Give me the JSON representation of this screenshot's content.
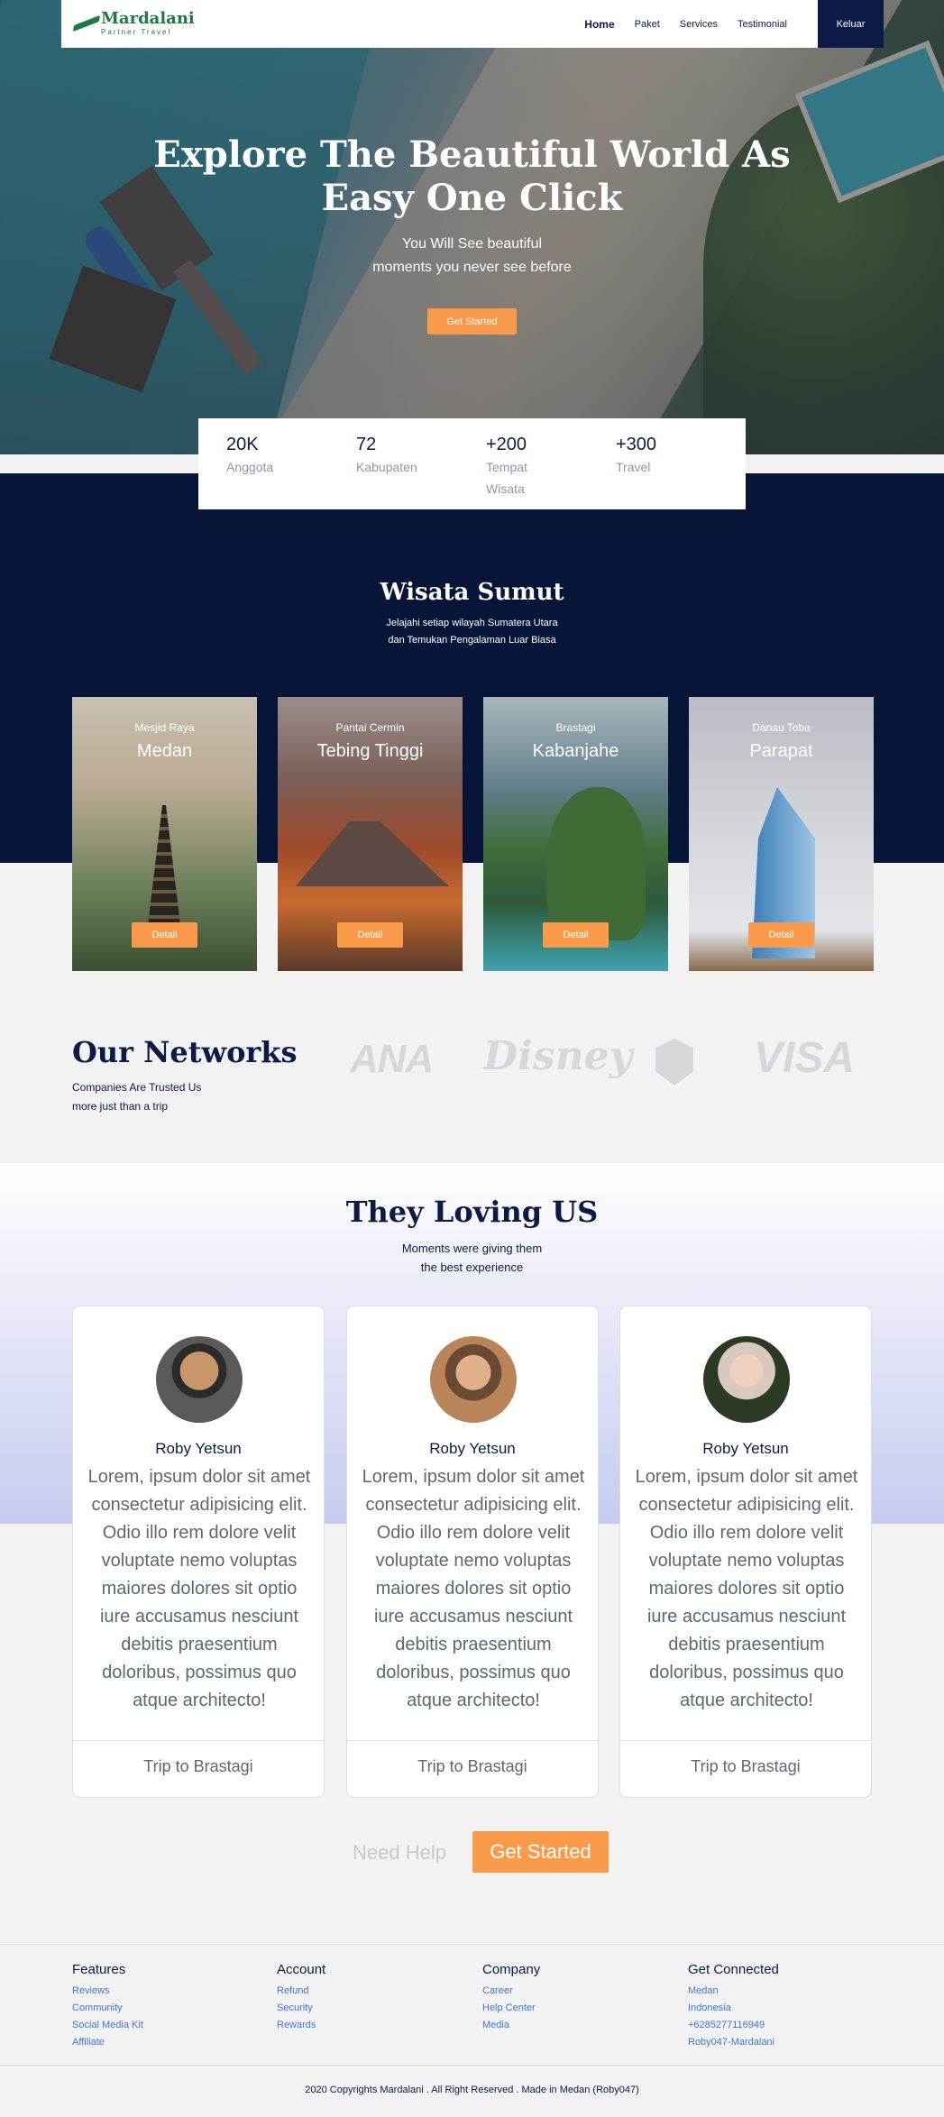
{
  "nav": {
    "logo_name": "Mardalani",
    "logo_tagline": "Partner Travel",
    "items": [
      {
        "label": "Home",
        "active": true
      },
      {
        "label": "Paket"
      },
      {
        "label": "Services"
      },
      {
        "label": "Testimonial"
      }
    ],
    "logout_label": "Keluar"
  },
  "hero": {
    "title_line1": "Explore The Beautiful World As",
    "title_line2": "Easy One Click",
    "subtitle_line1": "You Will See beautiful",
    "subtitle_line2": "moments you never see before",
    "button_label": "Get Started"
  },
  "stats": [
    {
      "value": "20K",
      "label": "Anggota"
    },
    {
      "value": "72",
      "label": "Kabupaten"
    },
    {
      "value": "+200",
      "label": "Tempat Wisata"
    },
    {
      "value": "+300",
      "label": "Travel"
    }
  ],
  "wisata": {
    "title": "Wisata Sumut",
    "subtitle_line1": "Jelajahi setiap wilayah Sumatera Utara",
    "subtitle_line2": "dan Temukan Pengalaman Luar Biasa",
    "cards": [
      {
        "place": "Mesjid Raya",
        "city": "Medan",
        "button": "Detail"
      },
      {
        "place": "Pantai Cermin",
        "city": "Tebing Tinggi",
        "button": "Detail"
      },
      {
        "place": "Brastagi",
        "city": "Kabanjahe",
        "button": "Detail"
      },
      {
        "place": "Danau Toba",
        "city": "Parapat",
        "button": "Detail"
      }
    ]
  },
  "networks": {
    "title": "Our Networks",
    "subtitle_line1": "Companies Are Trusted Us",
    "subtitle_line2": "more just than a trip",
    "brands": [
      "ANA",
      "Disney",
      "VISA"
    ]
  },
  "testimonials": {
    "title": "They Loving US",
    "subtitle_line1": "Moments were giving them",
    "subtitle_line2": "the best experience",
    "items": [
      {
        "name": "Roby Yetsun",
        "quote": "Lorem, ipsum dolor sit amet consectetur adipisicing elit. Odio illo rem dolore velit voluptate nemo voluptas maiores dolores sit optio iure accusamus nesciunt debitis praesentium doloribus, possimus quo atque architecto!",
        "trip": "Trip to Brastagi"
      },
      {
        "name": "Roby Yetsun",
        "quote": "Lorem, ipsum dolor sit amet consectetur adipisicing elit. Odio illo rem dolore velit voluptate nemo voluptas maiores dolores sit optio iure accusamus nesciunt debitis praesentium doloribus, possimus quo atque architecto!",
        "trip": "Trip to Brastagi"
      },
      {
        "name": "Roby Yetsun",
        "quote": "Lorem, ipsum dolor sit amet consectetur adipisicing elit. Odio illo rem dolore velit voluptate nemo voluptas maiores dolores sit optio iure accusamus nesciunt debitis praesentium doloribus, possimus quo atque architecto!",
        "trip": "Trip to Brastagi"
      }
    ]
  },
  "cta": {
    "help_label": "Need Help",
    "button_label": "Get Started"
  },
  "footer": {
    "columns": [
      {
        "title": "Features",
        "links": [
          "Reviews",
          "Community",
          "Social Media Kit",
          "Affiliate"
        ]
      },
      {
        "title": "Account",
        "links": [
          "Refund",
          "Security",
          "Rewards"
        ]
      },
      {
        "title": "Company",
        "links": [
          "Career",
          "Help Center",
          "Media"
        ]
      },
      {
        "title": "Get Connected",
        "links": [
          "Medan",
          "Indonesia",
          "+6285277116949",
          "Roby047-Mardalani"
        ]
      }
    ],
    "copyright": "2020 Copyrights Mardalani . All Right Reserved . Made in Medan (Roby047)"
  },
  "colors": {
    "navy": "#0b1b45",
    "dark_section": "#071538",
    "accent_orange": "#f99b4a",
    "logo_green": "#1e7a45",
    "link_blue": "#3f77d8"
  }
}
